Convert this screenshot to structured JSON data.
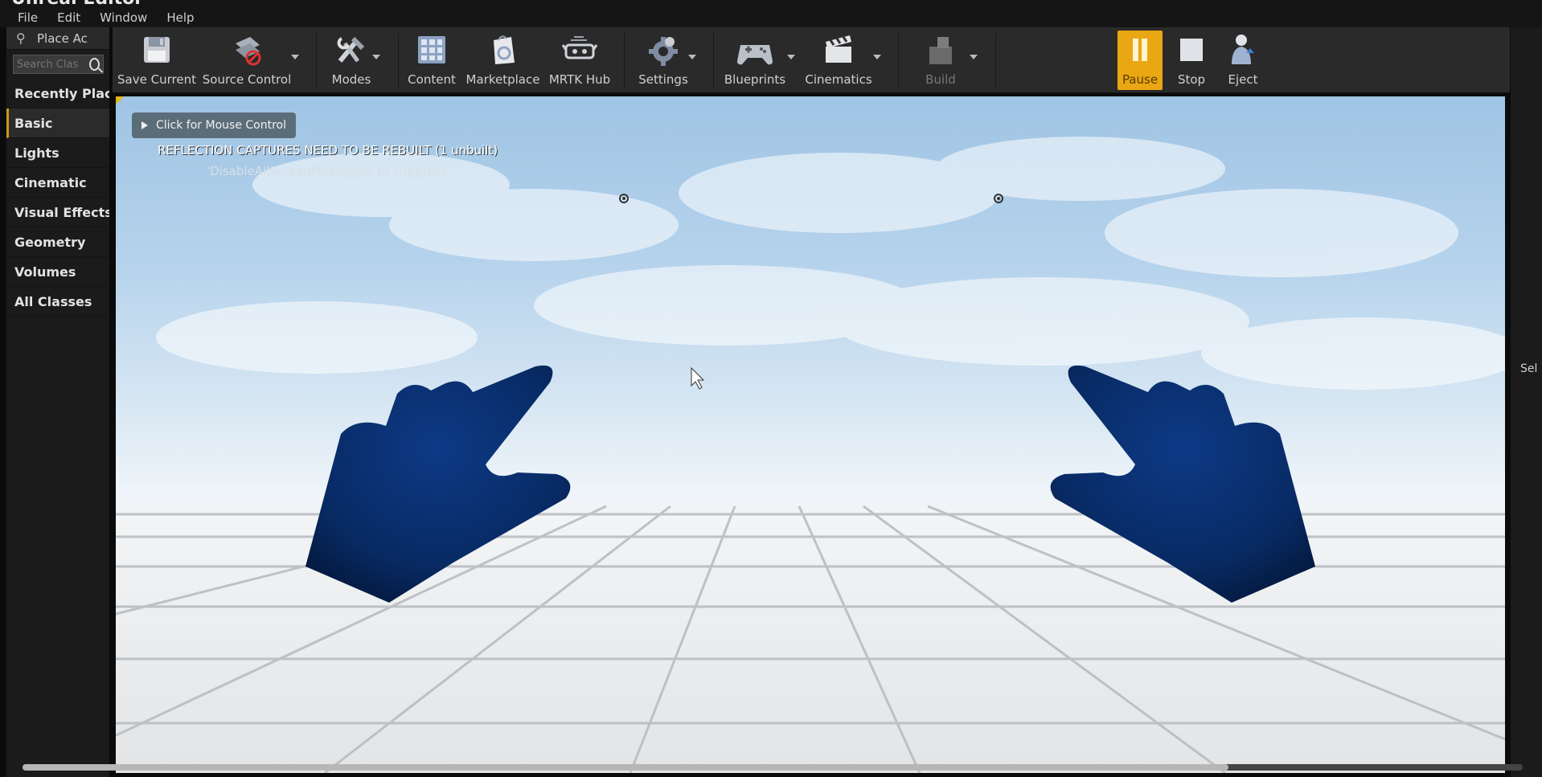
{
  "window": {
    "title": "Unreal Editor"
  },
  "menu": [
    "File",
    "Edit",
    "Window",
    "Help"
  ],
  "place_actors": {
    "tab_label": "Place Ac",
    "search_placeholder": "Search Clas",
    "categories": [
      "Recently Placed",
      "Basic",
      "Lights",
      "Cinematic",
      "Visual Effects",
      "Geometry",
      "Volumes",
      "All Classes"
    ],
    "active_category": "Basic"
  },
  "toolbar": {
    "save_current": "Save Current",
    "source_control": "Source Control",
    "modes": "Modes",
    "content": "Content",
    "marketplace": "Marketplace",
    "mrtk_hub": "MRTK Hub",
    "settings": "Settings",
    "blueprints": "Blueprints",
    "cinematics": "Cinematics",
    "build": "Build",
    "pause": "Pause",
    "stop": "Stop",
    "eject": "Eject"
  },
  "viewport": {
    "mouse_control": "Click for Mouse Control",
    "warning": "REFLECTION CAPTURES NEED TO BE REBUILT (1 unbuilt)",
    "suppress_hint": "'DisableAllScreenMessages' to suppress"
  },
  "right_panel": {
    "label": "Sel"
  },
  "colors": {
    "accent": "#e9a714",
    "hand": "#0a2e6b",
    "panel": "#1b1b1b"
  }
}
